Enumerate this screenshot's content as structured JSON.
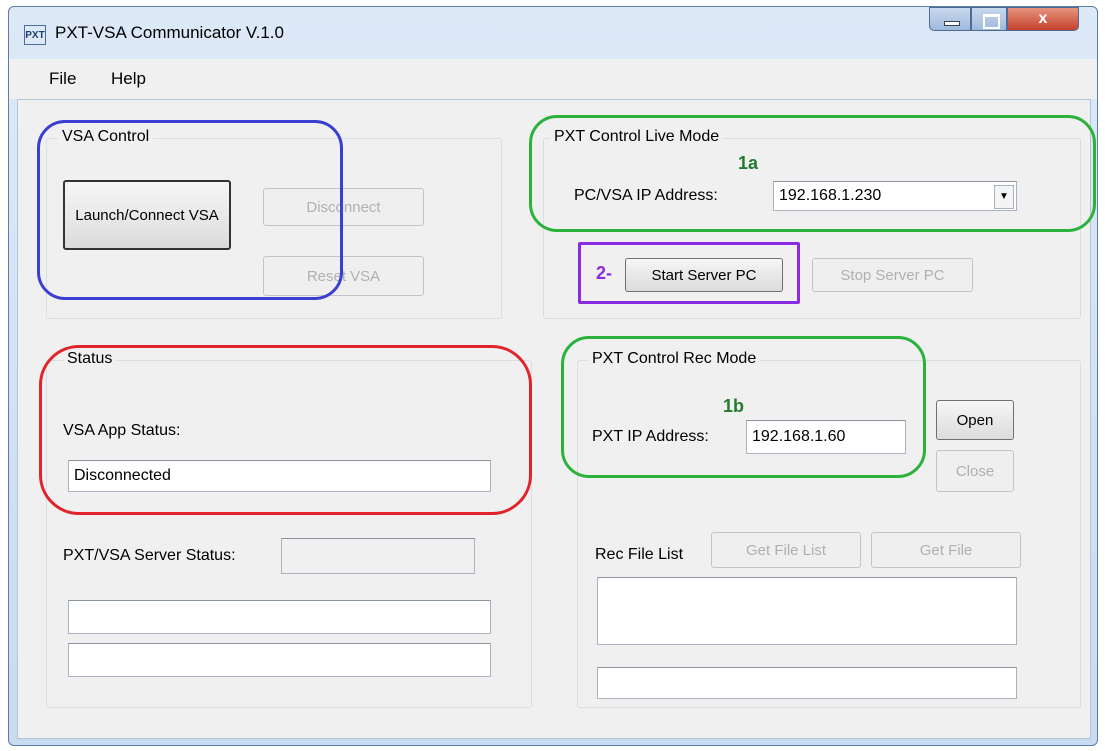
{
  "window": {
    "title": "PXT-VSA Communicator V.1.0",
    "icon": "app-icon",
    "close_glyph": "x"
  },
  "menu": [
    "File",
    "Help"
  ],
  "vsa_control": {
    "legend": "VSA Control",
    "launch_button": "Launch/Connect VSA",
    "disconnect_button": "Disconnect",
    "reset_button": "Reset VSA"
  },
  "live_mode": {
    "legend": "PXT Control Live Mode",
    "ip_label": "PC/VSA IP Address:",
    "ip_value": "192.168.1.230",
    "start_button": "Start Server PC",
    "stop_button": "Stop Server PC"
  },
  "status": {
    "legend": "Status",
    "app_status_label": "VSA App Status:",
    "app_status_value": "Disconnected",
    "server_status_label": "PXT/VSA Server Status:",
    "server_status_value": "",
    "line1": "",
    "line2": ""
  },
  "rec_mode": {
    "legend": "PXT Control Rec Mode",
    "ip_label": "PXT IP Address:",
    "ip_value": "192.168.1.60",
    "open_button": "Open",
    "close_button": "Close",
    "file_list_label": "Rec File List",
    "get_file_list_button": "Get File List",
    "get_file_button": "Get File"
  },
  "annotations": {
    "a1": "1a",
    "a2": "2-",
    "b1": "1b",
    "colors": {
      "blue": "#3a3fd2",
      "green": "#2bb23a",
      "red": "#e0242a",
      "purple": "#8a2be2",
      "label_green": "#217a30"
    }
  }
}
